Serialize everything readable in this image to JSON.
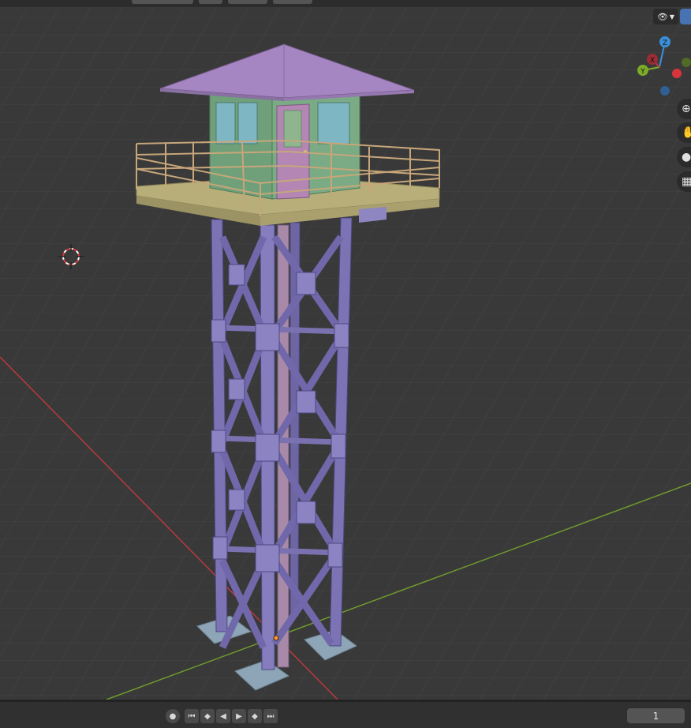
{
  "viewport": {
    "gizmo": {
      "x_label": "X",
      "y_label": "Y",
      "z_label": "Z"
    }
  },
  "overlay": {
    "visibility_icon": "eye-icon",
    "toggle_icon": "chevron-down-icon"
  },
  "navigation": [
    {
      "name": "zoom",
      "icon": "magnifier-plus-icon"
    },
    {
      "name": "pan",
      "icon": "hand-icon"
    },
    {
      "name": "camera",
      "icon": "camera-icon"
    },
    {
      "name": "perspective",
      "icon": "grid-icon"
    }
  ],
  "timeline": {
    "record_icon": "record-icon",
    "controls": [
      "jump-start-icon",
      "prev-keyframe-icon",
      "play-reverse-icon",
      "play-icon",
      "next-keyframe-icon",
      "jump-end-icon"
    ],
    "current_frame": "1"
  },
  "colors": {
    "x_axis": "#c5343c",
    "y_axis": "#7cab2a",
    "z_axis": "#3b8fd8",
    "roof": "#a585c2",
    "cabin": "#6fa07a",
    "door": "#b386b4",
    "deck": "#b8ae7a",
    "steel": "#7a72b0",
    "footing": "#8fa8b8"
  }
}
